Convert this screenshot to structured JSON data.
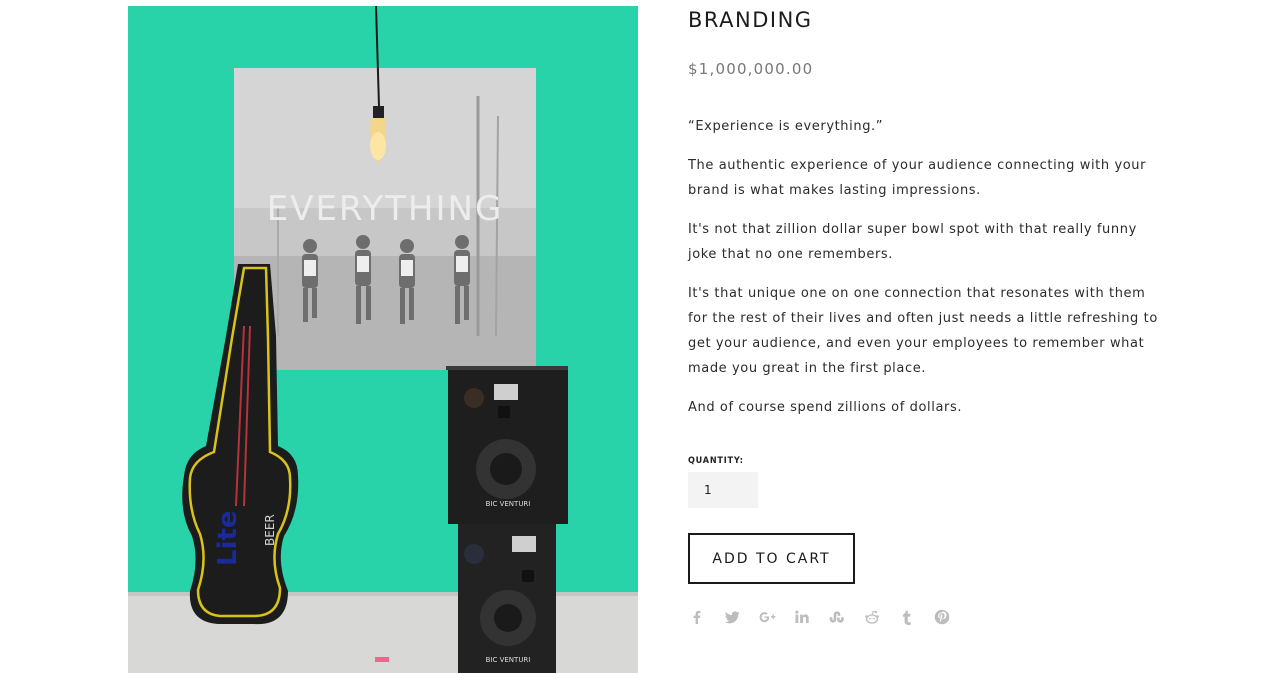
{
  "product": {
    "title": "BRANDING",
    "price": "$1,000,000.00",
    "image_poster_text": "EVERYTHING",
    "image_guitar_text_1": "Lite",
    "image_guitar_text_2": "BEER",
    "image_speaker_brand": "BIC VENTURI"
  },
  "description": [
    "“Experience is everything.”",
    "The authentic experience of your audience connecting with your brand is what makes lasting impressions.",
    "It's not that zillion dollar super bowl spot with that really funny joke that no one remembers.",
    "It's that unique one on one connection that resonates with them for the rest of their lives and often just needs a little refreshing to get your audience, and even your employees to remember what made you great in the first place.",
    "And of course spend zillions of dollars."
  ],
  "purchase": {
    "quantity_label": "QUANTITY:",
    "quantity_value": "1",
    "add_to_cart_label": "ADD TO CART"
  },
  "share_icons": [
    "facebook-icon",
    "twitter-icon",
    "google-plus-icon",
    "linkedin-icon",
    "stumbleupon-icon",
    "reddit-icon",
    "tumblr-icon",
    "pinterest-icon"
  ],
  "colors": {
    "image_background": "#29d3aa",
    "button_border": "#1a1a1a",
    "price_text": "#777777",
    "share_icon": "#bdbdbd"
  }
}
